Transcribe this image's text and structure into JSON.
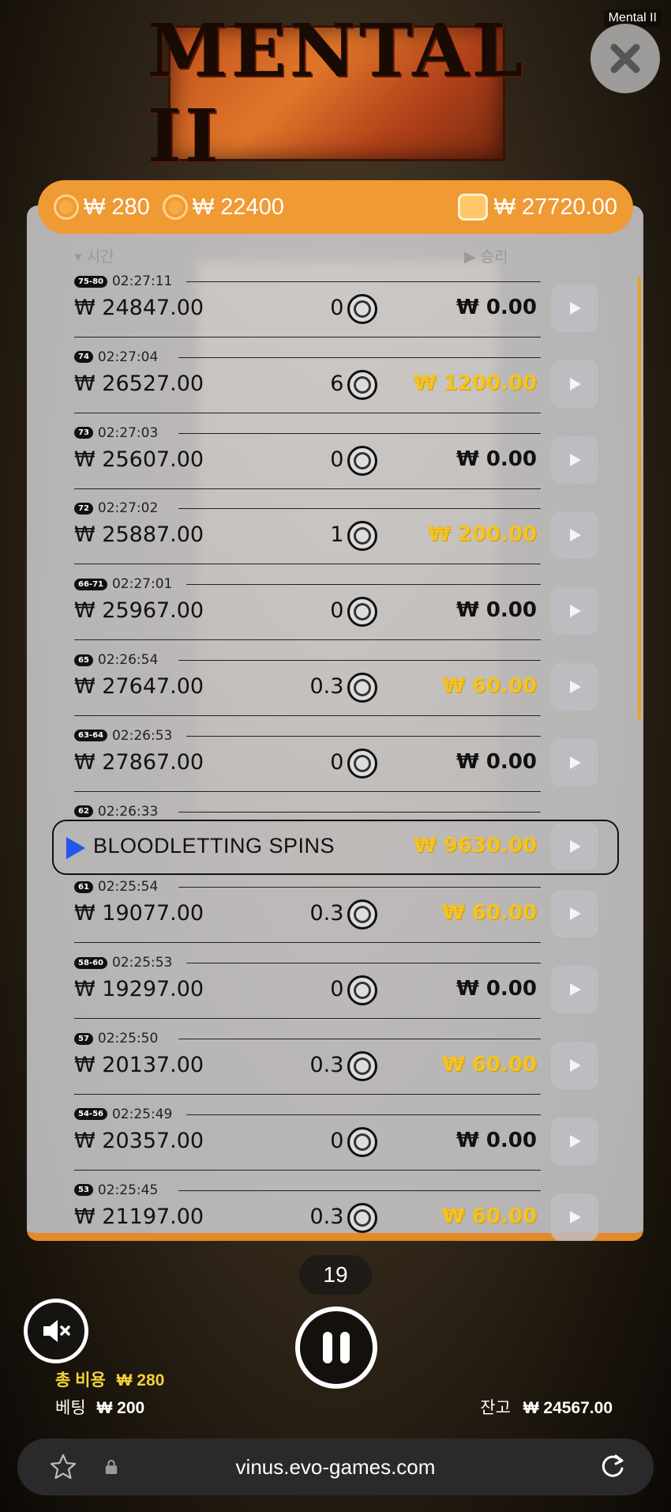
{
  "window": {
    "title": "Mental II"
  },
  "game": {
    "logo_text": "MENTAL II"
  },
  "topbar": {
    "coin1": "₩ 280",
    "coin2": "₩ 22400",
    "balance": "₩ 27720.00"
  },
  "columns": {
    "time": "▾ 시간",
    "win": "▶ 승리"
  },
  "rows": [
    {
      "tag": "75-80",
      "time": "02:27:11",
      "bet": "₩ 24847.00",
      "mult": "0 x",
      "win": "₩ 0.00",
      "gold": false
    },
    {
      "tag": "74",
      "time": "02:27:04",
      "bet": "₩ 26527.00",
      "mult": "6 x",
      "win": "₩ 1200.00",
      "gold": true
    },
    {
      "tag": "73",
      "time": "02:27:03",
      "bet": "₩ 25607.00",
      "mult": "0 x",
      "win": "₩ 0.00",
      "gold": false
    },
    {
      "tag": "72",
      "time": "02:27:02",
      "bet": "₩ 25887.00",
      "mult": "1 x",
      "win": "₩ 200.00",
      "gold": true
    },
    {
      "tag": "66-71",
      "time": "02:27:01",
      "bet": "₩ 25967.00",
      "mult": "0 x",
      "win": "₩ 0.00",
      "gold": false
    },
    {
      "tag": "65",
      "time": "02:26:54",
      "bet": "₩ 27647.00",
      "mult": "0.3 x",
      "win": "₩ 60.00",
      "gold": true
    },
    {
      "tag": "63-64",
      "time": "02:26:53",
      "bet": "₩ 27867.00",
      "mult": "0 x",
      "win": "₩ 0.00",
      "gold": false
    },
    {
      "tag": "62",
      "time": "02:26:33",
      "special": "BLOODLETTING SPINS",
      "win": "₩ 9630.00",
      "gold": true
    },
    {
      "tag": "61",
      "time": "02:25:54",
      "bet": "₩ 19077.00",
      "mult": "0.3 x",
      "win": "₩ 60.00",
      "gold": true
    },
    {
      "tag": "58-60",
      "time": "02:25:53",
      "bet": "₩ 19297.00",
      "mult": "0 x",
      "win": "₩ 0.00",
      "gold": false
    },
    {
      "tag": "57",
      "time": "02:25:50",
      "bet": "₩ 20137.00",
      "mult": "0.3 x",
      "win": "₩ 60.00",
      "gold": true
    },
    {
      "tag": "54-56",
      "time": "02:25:49",
      "bet": "₩ 20357.00",
      "mult": "0 x",
      "win": "₩ 0.00",
      "gold": false
    },
    {
      "tag": "53",
      "time": "02:25:45",
      "bet": "₩ 21197.00",
      "mult": "0.3 x",
      "win": "₩ 60.00",
      "gold": true
    }
  ],
  "controls": {
    "spin_counter": "19"
  },
  "footer": {
    "total_cost_label": "총 비용",
    "total_cost_value": "₩ 280",
    "bet_label": "베팅",
    "bet_value": "₩ 200",
    "balance_label": "잔고",
    "balance_value": "₩ 24567.00"
  },
  "browser": {
    "url": "vinus.evo-games.com"
  },
  "colors": {
    "accent_orange": "#f09a34",
    "gold": "#f2c227",
    "spin_arrow": "#2255ee"
  }
}
